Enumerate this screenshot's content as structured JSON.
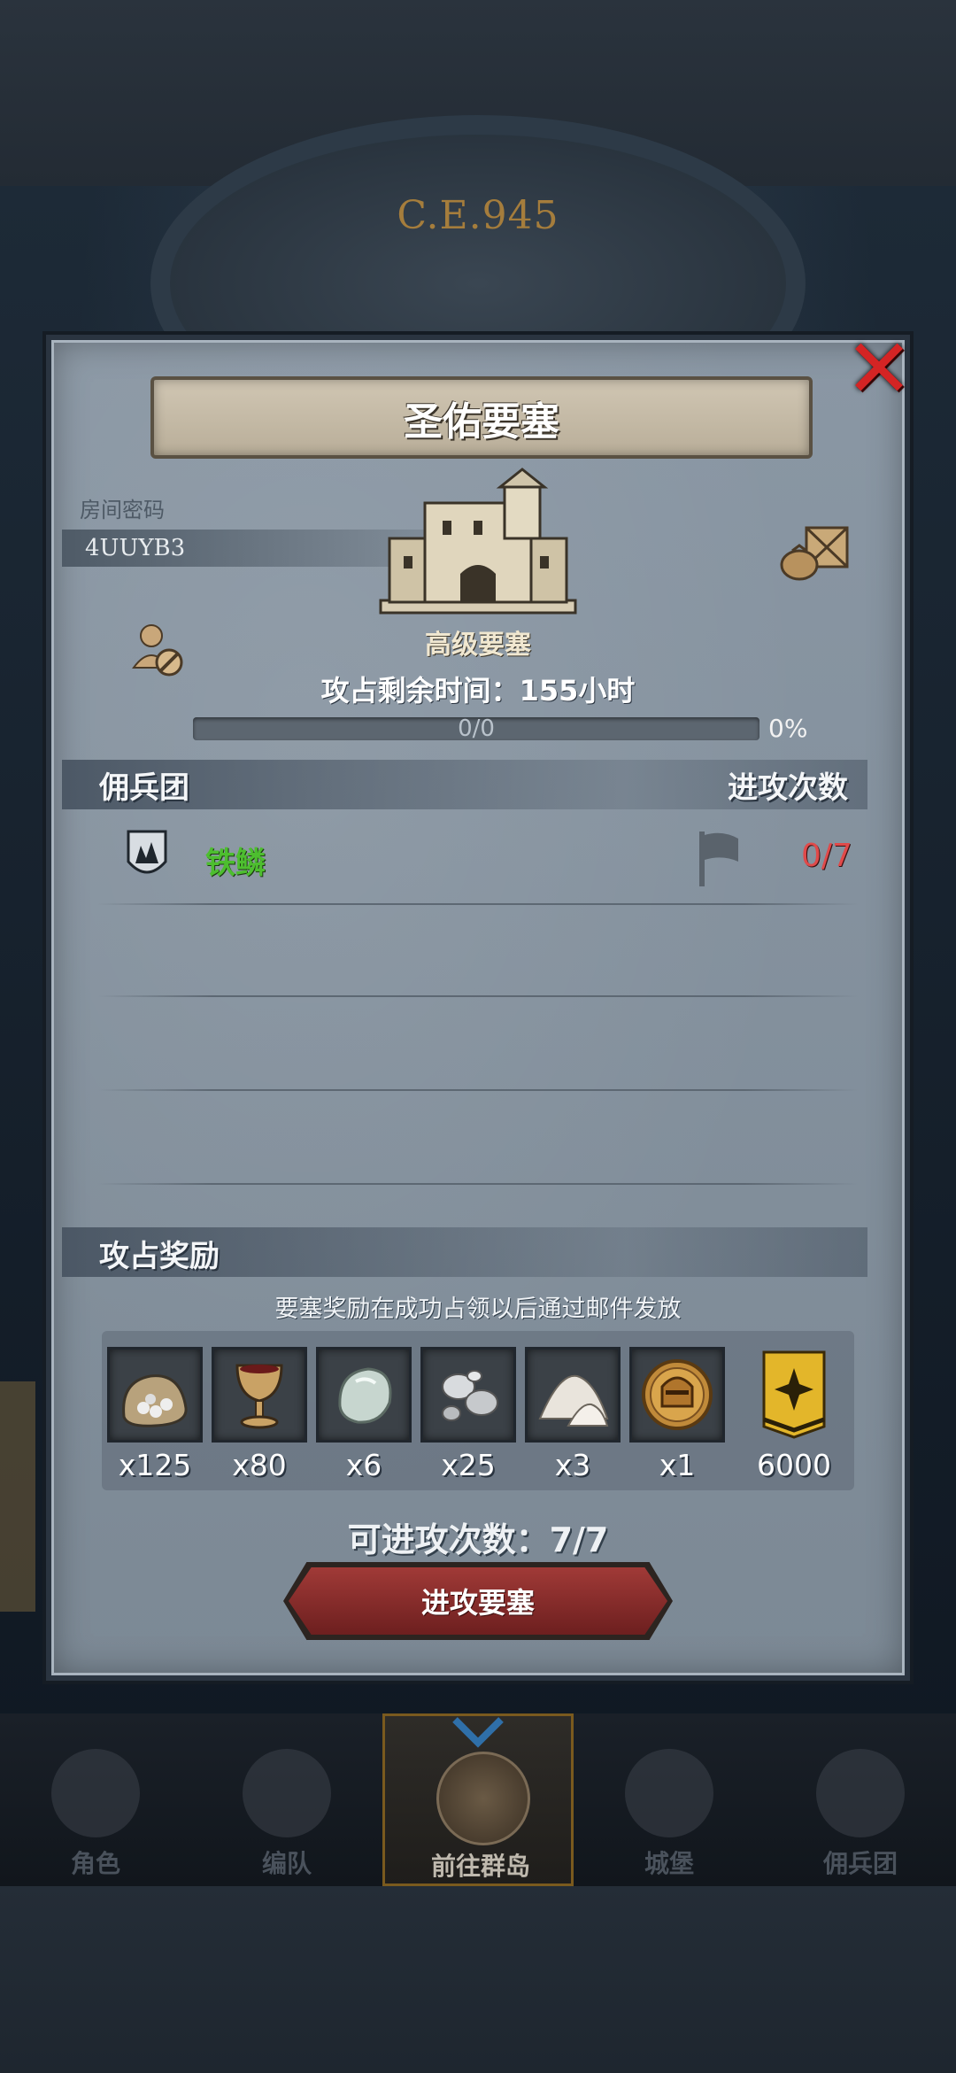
{
  "modal": {
    "title": "圣佑要塞",
    "room_code_label": "房间密码",
    "room_code": "4UUYB3",
    "fortress_level": "高级要塞",
    "remaining_time": "攻占剩余时间：155小时",
    "progress_text": "0/0",
    "progress_percent": "0%",
    "progress_value": 0
  },
  "mercenary": {
    "header": "佣兵团",
    "attacks_header": "进攻次数",
    "rows": [
      {
        "name": "铁鳞",
        "attacks": "0/7"
      }
    ]
  },
  "rewards": {
    "header": "攻占奖励",
    "note": "要塞奖励在成功占领以后通过邮件发放",
    "items": [
      {
        "icon": "grain-sack-icon",
        "qty": "x125"
      },
      {
        "icon": "goblet-icon",
        "qty": "x80"
      },
      {
        "icon": "moonstone-icon",
        "qty": "x6"
      },
      {
        "icon": "silver-ore-icon",
        "qty": "x25"
      },
      {
        "icon": "salt-pile-icon",
        "qty": "x3"
      },
      {
        "icon": "knight-helmet-medal-icon",
        "qty": "x1"
      },
      {
        "icon": "guild-banner-icon",
        "qty": "6000"
      }
    ]
  },
  "attacks_available": "可进攻次数：7/7",
  "attack_button": "进攻要塞",
  "bottom_nav": [
    {
      "label": "角色"
    },
    {
      "label": "编队"
    },
    {
      "label": "前往群岛",
      "active": true
    },
    {
      "label": "城堡"
    },
    {
      "label": "佣兵团"
    }
  ],
  "background": {
    "dial_text": "C.E.945"
  },
  "colors": {
    "guild_name": "#4dbe2f",
    "attack_count": "#e04a4a",
    "close": "#d42424"
  }
}
